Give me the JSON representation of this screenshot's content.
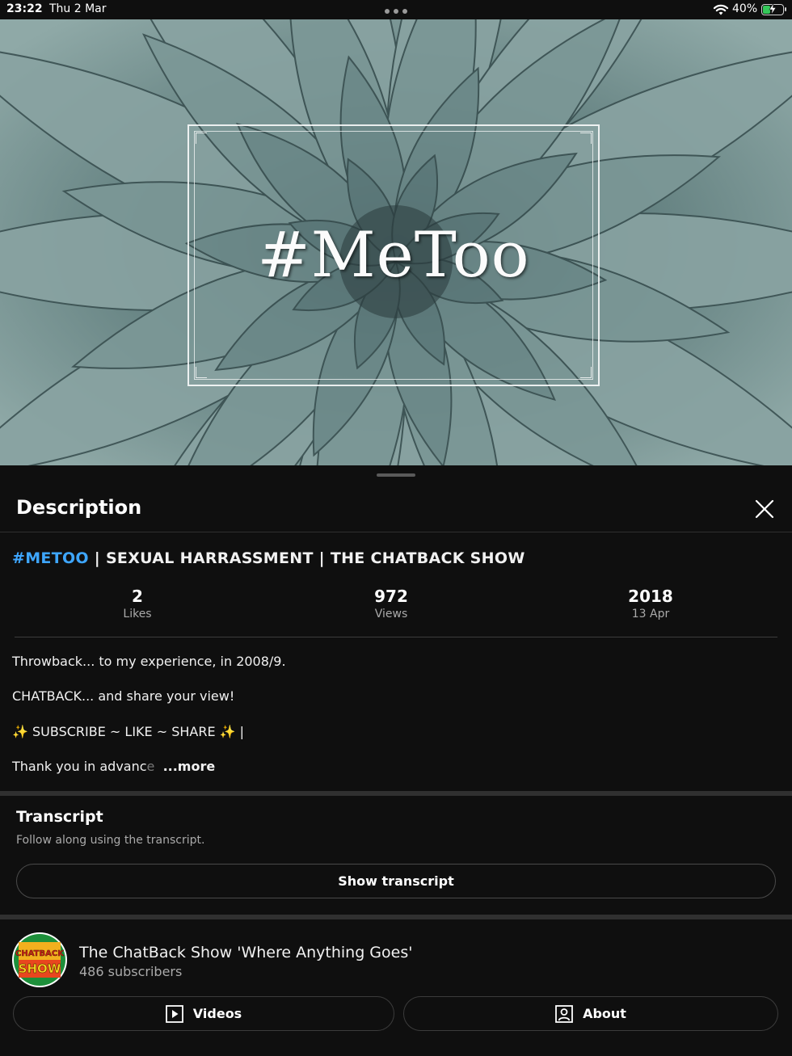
{
  "status_bar": {
    "time": "23:22",
    "date": "Thu 2 Mar",
    "battery_percent": "40%",
    "battery_level": 0.4
  },
  "video": {
    "overlay_text": "#MeToo"
  },
  "panel": {
    "title": "Description",
    "video_title_hashtag": "#METOO",
    "video_title_rest": " | SEXUAL HARRASSMENT | THE CHATBACK SHOW",
    "stats": [
      {
        "value": "2",
        "label": "Likes"
      },
      {
        "value": "972",
        "label": "Views"
      },
      {
        "value": "2018",
        "label": "13 Apr"
      }
    ],
    "description_lines": [
      "Throwback... to my experience, in 2008/9.",
      "CHATBACK... and share your view!",
      "✨ SUBSCRIBE ~ LIKE ~ SHARE ✨ |"
    ],
    "description_truncated": "Thank you in advanc",
    "description_fade": "e",
    "more_label": "...more"
  },
  "transcript": {
    "title": "Transcript",
    "subtitle": "Follow along using the transcript.",
    "button_label": "Show transcript"
  },
  "channel": {
    "name": "The ChatBack Show 'Where Anything Goes'",
    "subscribers": "486 subscribers",
    "avatar_text_top": "CHATBACK",
    "avatar_text_bottom": "SHOW",
    "videos_label": "Videos",
    "about_label": "About"
  },
  "colors": {
    "accent_link": "#3ea6ff",
    "background": "#0f0f0f"
  }
}
